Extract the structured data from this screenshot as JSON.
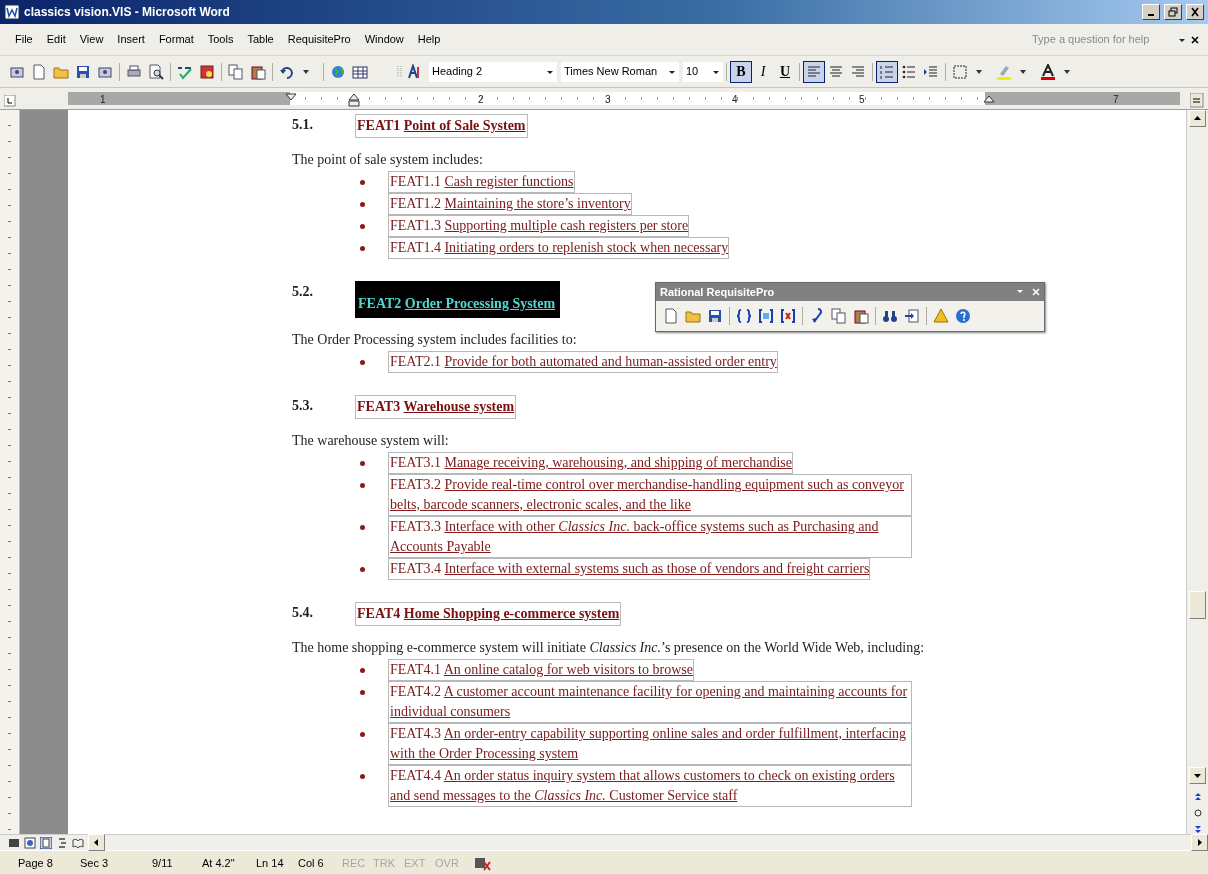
{
  "window": {
    "title": "classics vision.VIS - Microsoft Word"
  },
  "menu": [
    "File",
    "Edit",
    "View",
    "Insert",
    "Format",
    "Tools",
    "Table",
    "RequisitePro",
    "Window",
    "Help"
  ],
  "help_box": {
    "placeholder": "Type a question for help"
  },
  "formatting": {
    "style": "Heading 2",
    "font": "Times New Roman",
    "size": "10",
    "text_buttons": [
      {
        "label": "B",
        "selected": true
      },
      {
        "label": "I",
        "selected": false
      },
      {
        "label": "U",
        "selected": false
      }
    ],
    "paragraph_buttons": [
      {
        "kind": "align-left",
        "selected": true
      },
      {
        "kind": "center",
        "selected": false
      },
      {
        "kind": "align-right",
        "selected": false
      },
      {
        "kind": "numbering",
        "selected": true
      },
      {
        "kind": "bullets",
        "selected": false
      },
      {
        "kind": "indent",
        "selected": false
      }
    ]
  },
  "ruler": {
    "labels": [
      "1",
      "2",
      "3",
      "4",
      "5",
      "7"
    ]
  },
  "document": {
    "sections": [
      {
        "number": "5.1.",
        "tag": "FEAT1",
        "title": "Point of Sale System",
        "selected": false,
        "intro": "The point of sale system includes:",
        "items": [
          {
            "tag": "FEAT1.1",
            "text": "Cash register functions"
          },
          {
            "tag": "FEAT1.2",
            "text": "Maintaining the store’s inventory"
          },
          {
            "tag": "FEAT1.3",
            "text": "Supporting multiple cash registers per store"
          },
          {
            "tag": "FEAT1.4",
            "text": "Initiating orders to replenish stock when necessary"
          }
        ]
      },
      {
        "number": "5.2.",
        "tag": "FEAT2",
        "title": "Order Processing System",
        "selected": true,
        "intro": "The Order Processing system includes facilities to:",
        "items": [
          {
            "tag": "FEAT2.1",
            "text": "Provide for both automated and human-assisted order entry"
          }
        ]
      },
      {
        "number": "5.3.",
        "tag": "FEAT3",
        "title": "Warehouse system",
        "selected": false,
        "intro": "The warehouse system will:",
        "items": [
          {
            "tag": "FEAT3.1",
            "text": "Manage receiving, warehousing, and shipping of merchandise"
          },
          {
            "tag": "FEAT3.2",
            "text": "Provide real-time control over merchandise-handling equipment such as conveyor belts, barcode scanners, electronic scales, and the like"
          },
          {
            "tag": "FEAT3.3",
            "text": "Interface with other *Classics Inc.* back-office systems such as Purchasing and Accounts Payable"
          },
          {
            "tag": "FEAT3.4",
            "text": "Interface with external systems such as those of vendors and freight carriers"
          }
        ]
      },
      {
        "number": "5.4.",
        "tag": "FEAT4",
        "title": "Home Shopping e-commerce system",
        "selected": false,
        "intro": "The home shopping e-commerce system will initiate *Classics Inc.*’s presence on the World Wide Web, including:",
        "items": [
          {
            "tag": "FEAT4.1",
            "text": "An online catalog for web visitors to browse"
          },
          {
            "tag": "FEAT4.2",
            "text": "A customer account maintenance facility for opening and maintaining accounts for individual consumers"
          },
          {
            "tag": "FEAT4.3",
            "text": "An order-entry capability supporting online sales and order fulfillment, interfacing with the Order Processing system"
          },
          {
            "tag": "FEAT4.4",
            "text": "An order status inquiry system that allows customers to check on existing orders and send messages to the *Classics Inc.* Customer Service staff"
          }
        ]
      }
    ]
  },
  "requisitepro_toolbar": {
    "title": "Rational RequisitePro"
  },
  "status_bar": {
    "fields": [
      "Page 8",
      "Sec 3",
      "9/11",
      "At 4.2\"",
      "Ln 14",
      "Col 6"
    ],
    "modes": [
      {
        "label": "REC",
        "disabled": true
      },
      {
        "label": "TRK",
        "disabled": true
      },
      {
        "label": "EXT",
        "disabled": true
      },
      {
        "label": "OVR",
        "disabled": true
      }
    ]
  }
}
